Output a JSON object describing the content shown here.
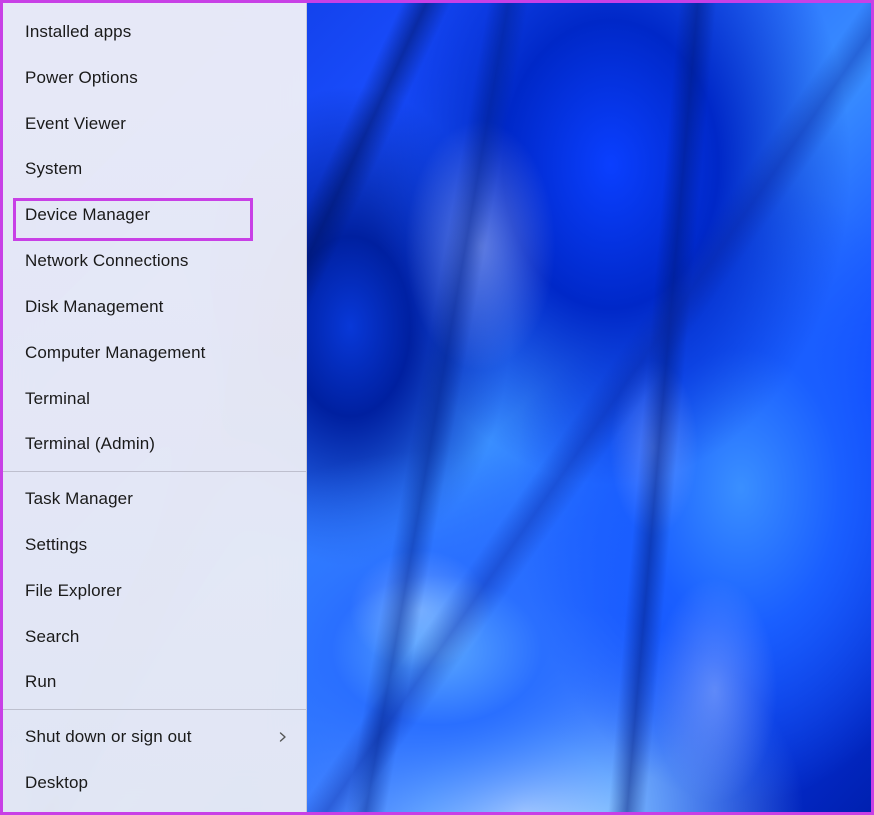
{
  "context_menu": {
    "groups": [
      {
        "items": [
          {
            "id": "installed-apps",
            "label": "Installed apps",
            "submenu": false,
            "highlighted": false
          },
          {
            "id": "power-options",
            "label": "Power Options",
            "submenu": false,
            "highlighted": false
          },
          {
            "id": "event-viewer",
            "label": "Event Viewer",
            "submenu": false,
            "highlighted": false
          },
          {
            "id": "system",
            "label": "System",
            "submenu": false,
            "highlighted": false
          },
          {
            "id": "device-manager",
            "label": "Device Manager",
            "submenu": false,
            "highlighted": true
          },
          {
            "id": "network-connections",
            "label": "Network Connections",
            "submenu": false,
            "highlighted": false
          },
          {
            "id": "disk-management",
            "label": "Disk Management",
            "submenu": false,
            "highlighted": false
          },
          {
            "id": "computer-management",
            "label": "Computer Management",
            "submenu": false,
            "highlighted": false
          },
          {
            "id": "terminal",
            "label": "Terminal",
            "submenu": false,
            "highlighted": false
          },
          {
            "id": "terminal-admin",
            "label": "Terminal (Admin)",
            "submenu": false,
            "highlighted": false
          }
        ]
      },
      {
        "items": [
          {
            "id": "task-manager",
            "label": "Task Manager",
            "submenu": false,
            "highlighted": false
          },
          {
            "id": "settings",
            "label": "Settings",
            "submenu": false,
            "highlighted": false
          },
          {
            "id": "file-explorer",
            "label": "File Explorer",
            "submenu": false,
            "highlighted": false
          },
          {
            "id": "search",
            "label": "Search",
            "submenu": false,
            "highlighted": false
          },
          {
            "id": "run",
            "label": "Run",
            "submenu": false,
            "highlighted": false
          }
        ]
      },
      {
        "items": [
          {
            "id": "shut-down",
            "label": "Shut down or sign out",
            "submenu": true,
            "highlighted": false
          },
          {
            "id": "desktop",
            "label": "Desktop",
            "submenu": false,
            "highlighted": false
          }
        ]
      }
    ]
  },
  "annotation": {
    "highlight_color": "#c840e6"
  }
}
